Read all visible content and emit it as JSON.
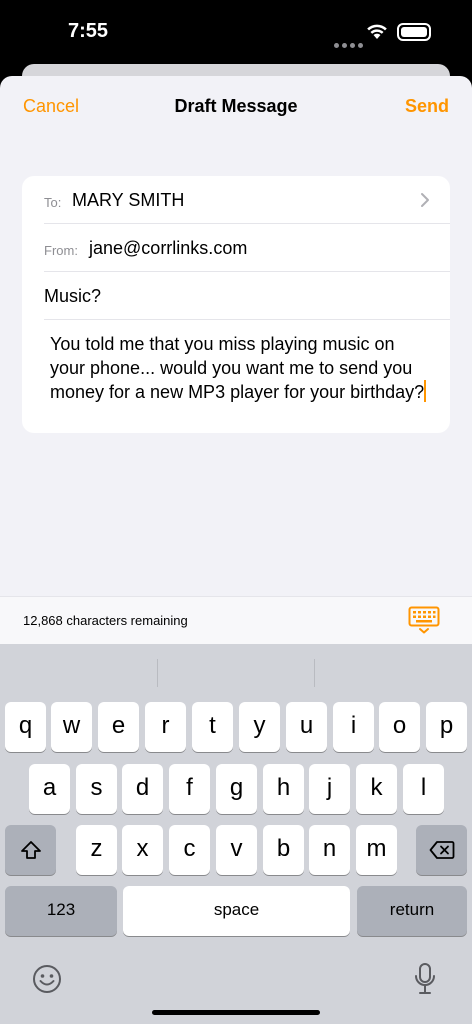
{
  "status": {
    "time": "7:55"
  },
  "nav": {
    "cancel": "Cancel",
    "title": "Draft Message",
    "send": "Send"
  },
  "compose": {
    "to_label": "To:",
    "to_value": "MARY SMITH",
    "from_label": "From:",
    "from_value": "jane@corrlinks.com",
    "subject": "Music?",
    "body": "You told me that you miss playing music on your phone... would you want me to send you money for a new MP3 player for your birthday?"
  },
  "toolbar": {
    "chars_remaining": "12,868 characters remaining"
  },
  "keyboard": {
    "row1": [
      "q",
      "w",
      "e",
      "r",
      "t",
      "y",
      "u",
      "i",
      "o",
      "p"
    ],
    "row2": [
      "a",
      "s",
      "d",
      "f",
      "g",
      "h",
      "j",
      "k",
      "l"
    ],
    "row3": [
      "z",
      "x",
      "c",
      "v",
      "b",
      "n",
      "m"
    ],
    "numbers_label": "123",
    "space_label": "space",
    "return_label": "return"
  },
  "colors": {
    "accent": "#ff9500",
    "keyboard_bg": "#d1d3d9",
    "sheet_bg": "#f2f2f7"
  },
  "icons": [
    "wifi-icon",
    "battery-icon",
    "chevron-right-icon",
    "keyboard-dismiss-icon",
    "shift-icon",
    "delete-icon",
    "emoji-icon",
    "microphone-icon"
  ]
}
